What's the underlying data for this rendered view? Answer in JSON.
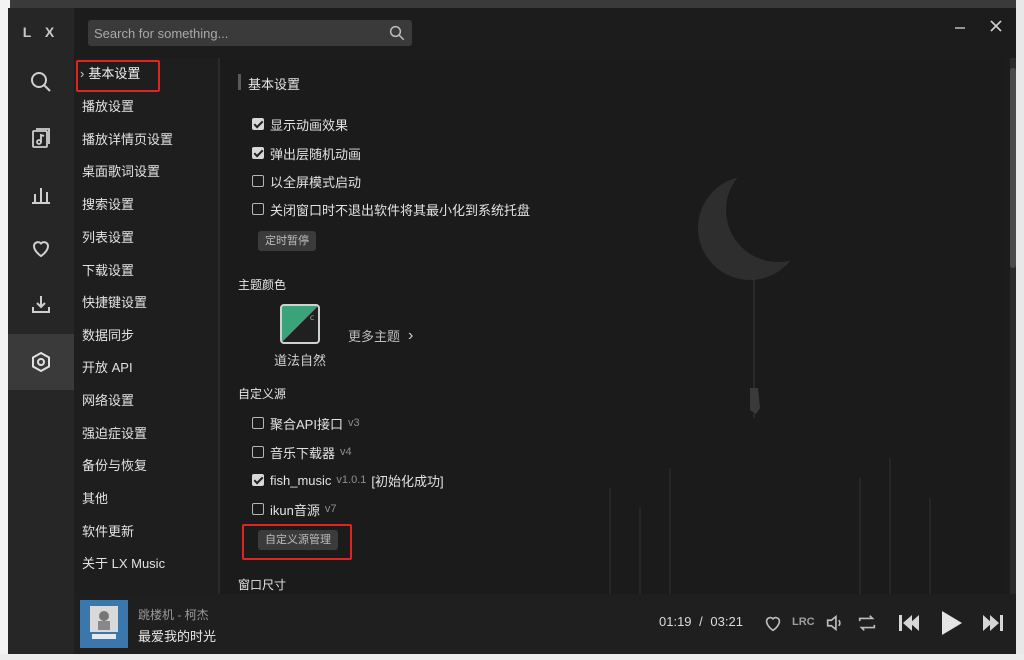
{
  "app": {
    "logo": "L X"
  },
  "search": {
    "placeholder": "Search for something..."
  },
  "nav_icons": [
    "search-icon",
    "music-playlist-icon",
    "chart-icon",
    "heart-icon",
    "download-icon",
    "gear-icon"
  ],
  "settings_menu": {
    "items": [
      "基本设置",
      "播放设置",
      "播放详情页设置",
      "桌面歌词设置",
      "搜索设置",
      "列表设置",
      "下载设置",
      "快捷键设置",
      "数据同步",
      "开放 API",
      "网络设置",
      "强迫症设置",
      "备份与恢复",
      "其他",
      "软件更新",
      "关于 LX Music"
    ],
    "current": "基本设置"
  },
  "basic": {
    "title": "基本设置",
    "checks": [
      {
        "label": "显示动画效果",
        "checked": true
      },
      {
        "label": "弹出层随机动画",
        "checked": true
      },
      {
        "label": "以全屏模式启动",
        "checked": false
      },
      {
        "label": "关闭窗口时不退出软件将其最小化到系统托盘",
        "checked": false
      }
    ],
    "timer_button": "定时暂停"
  },
  "theme": {
    "title": "主题颜色",
    "current_name": "道法自然",
    "more_label": "更多主题"
  },
  "custom_source": {
    "title": "自定义源",
    "items": [
      {
        "label": "聚合API接口",
        "version": "v3",
        "status": "",
        "checked": false
      },
      {
        "label": "音乐下载器",
        "version": "v4",
        "status": "",
        "checked": false
      },
      {
        "label": "fish_music",
        "version": "v1.0.1",
        "status": "[初始化成功]",
        "checked": true
      },
      {
        "label": "ikun音源",
        "version": "v7",
        "status": "",
        "checked": false
      }
    ],
    "manage_button": "自定义源管理"
  },
  "window_size": {
    "title": "窗口尺寸"
  },
  "player": {
    "song_title": "跳楼机 - 柯杰",
    "song_subtitle": "最爱我的时光",
    "current_time": "01:19",
    "total_time": "03:21",
    "time_sep": "/",
    "lrc_label": "LRC"
  },
  "colors": {
    "accent_highlight": "#e02424",
    "theme_green": "#3aa37a"
  }
}
